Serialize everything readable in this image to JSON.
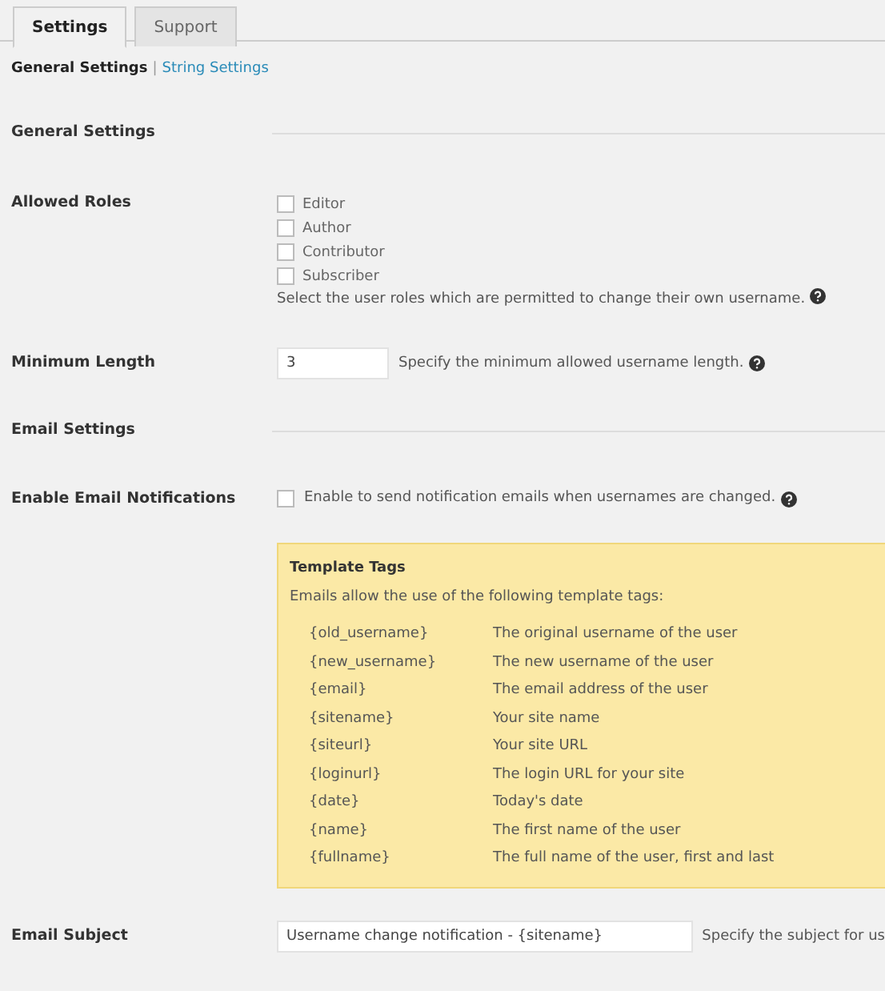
{
  "tabs": [
    {
      "label": "Settings",
      "selected": true
    },
    {
      "label": "Support",
      "selected": false
    }
  ],
  "subnav": [
    {
      "label": "General Settings",
      "selected": true
    },
    {
      "label": "String Settings",
      "selected": false
    }
  ],
  "subnav_separator": "|",
  "sections": [
    {
      "kind": "heading",
      "label": "General Settings"
    },
    {
      "kind": "checkboxes",
      "label": "Allowed Roles",
      "options": [
        {
          "label": "Editor",
          "checked": false
        },
        {
          "label": "Author",
          "checked": false
        },
        {
          "label": "Contributor",
          "checked": false
        },
        {
          "label": "Subscriber",
          "checked": false
        }
      ],
      "description": "Select the user roles which are permitted to change their own username."
    },
    {
      "kind": "number",
      "label": "Minimum Length",
      "value": "3",
      "description": "Specify the minimum allowed username length."
    },
    {
      "kind": "heading",
      "label": "Email Settings"
    },
    {
      "kind": "toggle",
      "label": "Enable Email Notifications",
      "checked": false,
      "description": "Enable to send notification emails when usernames are changed."
    },
    {
      "kind": "notice",
      "title": "Template Tags",
      "intro": "Emails allow the use of the following template tags:",
      "tags": [
        {
          "tag": "{old_username}",
          "meaning": "The original username of the user"
        },
        {
          "tag": "{new_username}",
          "meaning": "The new username of the user"
        },
        {
          "tag": "{email}",
          "meaning": "The email address of the user"
        },
        {
          "tag": "{sitename}",
          "meaning": "Your site name"
        },
        {
          "tag": "{siteurl}",
          "meaning": "Your site URL"
        },
        {
          "tag": "{loginurl}",
          "meaning": "The login URL for your site"
        },
        {
          "tag": "{date}",
          "meaning": "Today's date"
        },
        {
          "tag": "{name}",
          "meaning": "The first name of the user"
        },
        {
          "tag": "{fullname}",
          "meaning": "The full name of the user, first and last"
        }
      ]
    },
    {
      "kind": "text",
      "label": "Email Subject",
      "value": "Username change notification - {sitename}",
      "description": "Specify the subject for us"
    }
  ]
}
